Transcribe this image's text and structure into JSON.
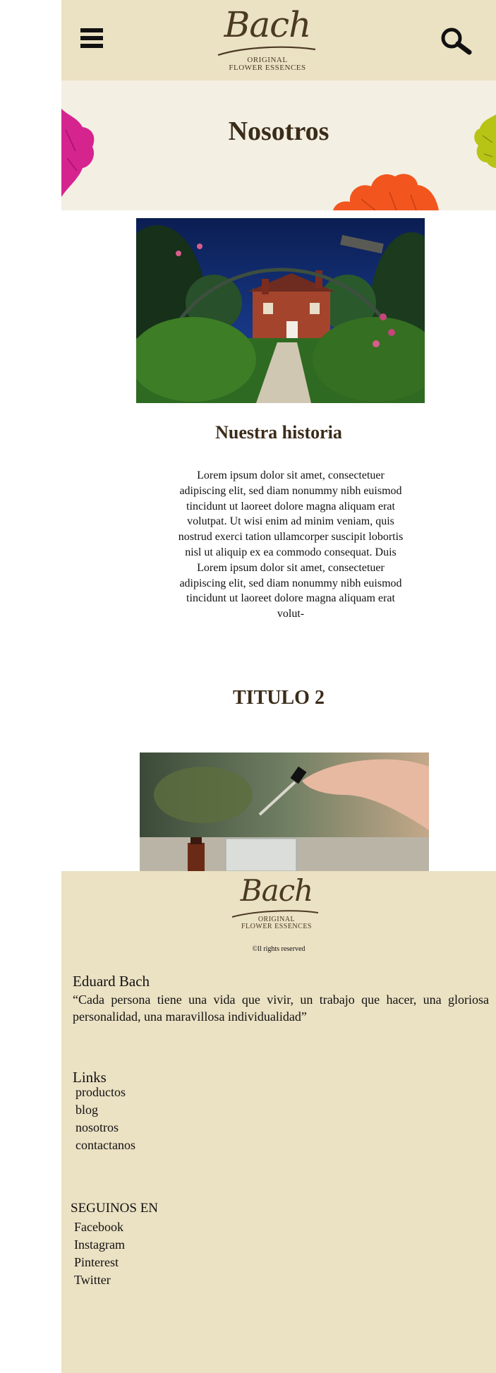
{
  "header": {
    "logo": {
      "script": "Bach",
      "line1": "ORIGINAL",
      "line2": "FLOWER ESSENCES"
    },
    "menu_icon": "hamburger-menu-icon",
    "search_icon": "search-icon"
  },
  "hero": {
    "title": "Nosotros"
  },
  "story": {
    "title": "Nuestra historia",
    "paragraph": "Lorem ipsum dolor sit amet, consectetuer adipiscing elit, sed diam nonummy nibh euismod tincidunt ut laoreet dolore magna aliquam erat volutpat. Ut wisi enim ad minim veniam, quis nostrud exerci tation ullamcorper suscipit lobortis nisl ut aliquip ex ea commodo consequat. Duis Lorem ipsum dolor sit amet, consectetuer adipiscing elit, sed diam nonummy nibh euismod tincidunt ut laoreet dolore magna aliquam erat volut-"
  },
  "section2": {
    "title": "TITULO 2"
  },
  "footer": {
    "logo": {
      "script": "Bach",
      "line1": "ORIGINAL",
      "line2": "FLOWER ESSENCES"
    },
    "rights": "©ll rights reserved",
    "quote_author": "Eduard Bach",
    "quote_text": "“Cada persona tiene una vida que vivir, un trabajo que hacer, una gloriosa personalidad, una maravillosa individualidad”",
    "links_title": "Links",
    "links": [
      "productos",
      "blog",
      "nosotros",
      "contactanos"
    ],
    "follow_title": "SEGUINOS EN",
    "social": [
      "Facebook",
      "Instagram",
      "Pinterest",
      "Twitter"
    ]
  },
  "colors": {
    "header_bg": "#ebe1c3",
    "hero_bg": "#f4efe3",
    "title_brown": "#3b2c1a",
    "flower_magenta": "#d6248f",
    "flower_orange": "#f2561e",
    "flower_lime": "#b7c416"
  }
}
